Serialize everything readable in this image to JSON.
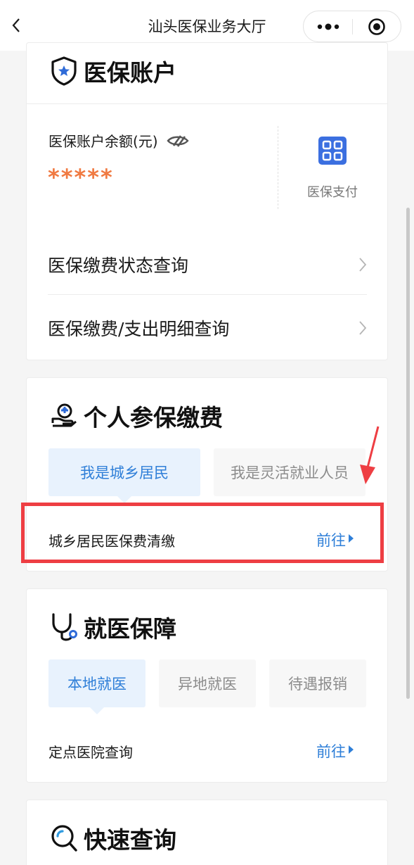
{
  "navbar": {
    "title": "汕头医保业务大厅",
    "back_icon": "chevron-left-icon",
    "more_icon": "more-dots-icon",
    "close_icon": "target-circle-icon"
  },
  "account": {
    "title": "医保账户",
    "title_icon": "shield-star-icon",
    "balance_label": "医保账户余额(元)",
    "visibility_icon": "eye-hidden-icon",
    "balance_value": "*****",
    "pay_icon": "qr-code-icon",
    "pay_label": "医保支付",
    "menu": [
      {
        "label": "医保缴费状态查询"
      },
      {
        "label": "医保缴费/支出明细查询"
      }
    ]
  },
  "personal": {
    "title": "个人参保缴费",
    "title_icon": "hand-medical-icon",
    "tabs": [
      {
        "label": "我是城乡居民",
        "active": true
      },
      {
        "label": "我是灵活就业人员",
        "active": false
      }
    ],
    "item_label": "城乡居民医保费清缴",
    "go_label": "前往"
  },
  "medical": {
    "title": "就医保障",
    "title_icon": "stethoscope-icon",
    "tabs": [
      {
        "label": "本地就医",
        "active": true
      },
      {
        "label": "异地就医",
        "active": false
      },
      {
        "label": "待遇报销",
        "active": false
      }
    ],
    "item_label": "定点医院查询",
    "go_label": "前往"
  },
  "quick": {
    "title": "快速查询",
    "title_icon": "search-magnifier-icon"
  },
  "colors": {
    "accent_blue": "#2f7fd8",
    "balance_orange": "#f07a42",
    "annotation_red": "#ee3e43",
    "active_tab_bg": "#e8f2fd"
  }
}
